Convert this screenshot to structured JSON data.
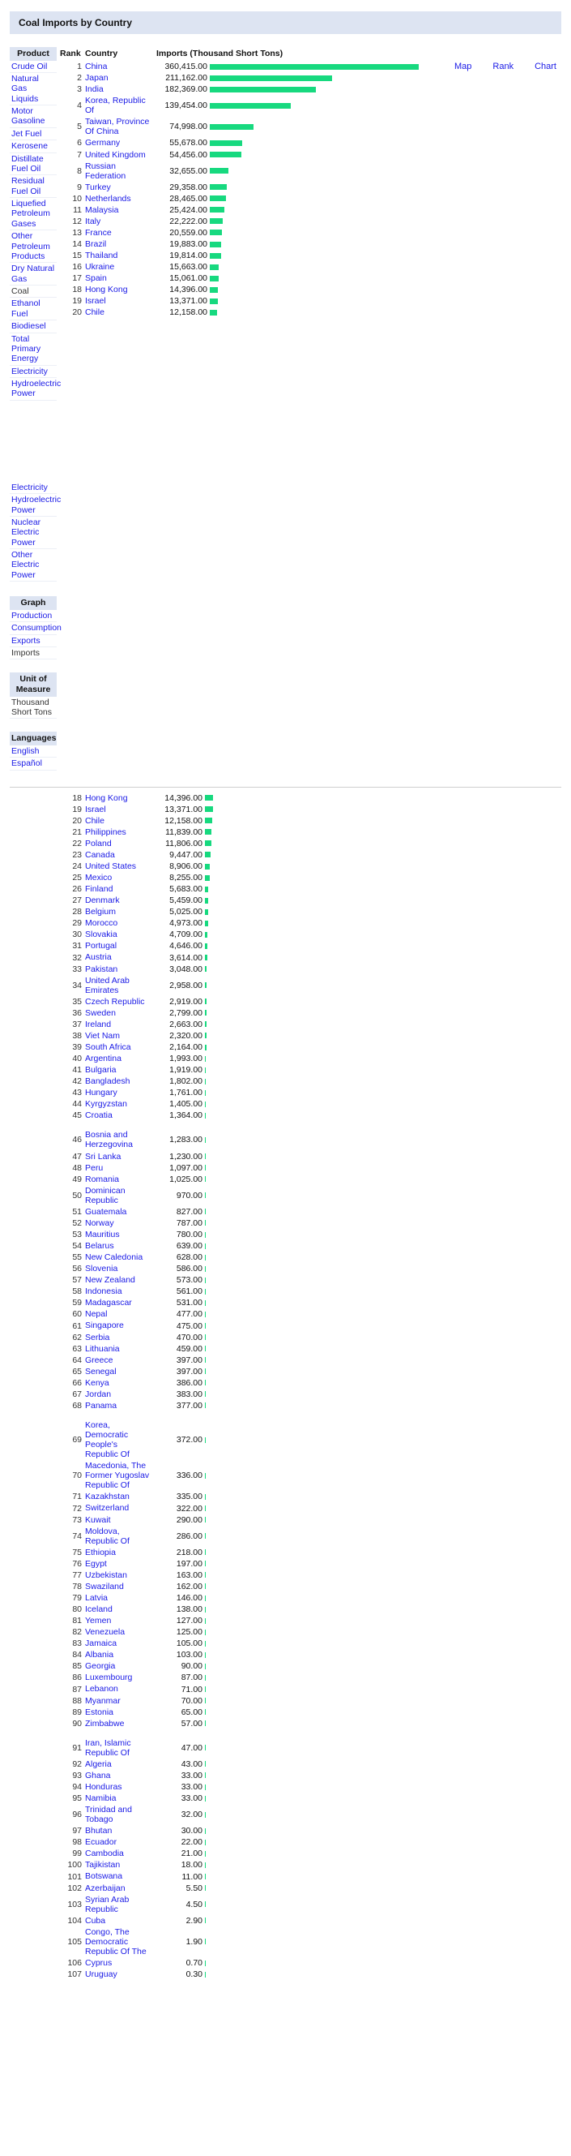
{
  "page": {
    "title": "Coal Imports by Country"
  },
  "view_links": [
    {
      "label": "Map",
      "name": "map-view-link"
    },
    {
      "label": "Rank",
      "name": "rank-view-link"
    },
    {
      "label": "Chart",
      "name": "chart-view-link"
    }
  ],
  "sidebar": {
    "product": {
      "header": "Product",
      "items": [
        {
          "label": "Crude Oil",
          "current": false
        },
        {
          "label": "Natural Gas Liquids",
          "current": false
        },
        {
          "label": "Motor Gasoline",
          "current": false
        },
        {
          "label": "Jet Fuel",
          "current": false
        },
        {
          "label": "Kerosene",
          "current": false
        },
        {
          "label": "Distillate Fuel Oil",
          "current": false
        },
        {
          "label": "Residual Fuel Oil",
          "current": false
        },
        {
          "label": "Liquefied Petroleum Gases",
          "current": false
        },
        {
          "label": "Other Petroleum Products",
          "current": false
        },
        {
          "label": "Dry Natural Gas",
          "current": false
        },
        {
          "label": "Coal",
          "current": true
        },
        {
          "label": "Ethanol Fuel",
          "current": false
        },
        {
          "label": "Biodiesel",
          "current": false
        },
        {
          "label": "Total Primary Energy",
          "current": false
        },
        {
          "label": "Electricity",
          "current": false
        },
        {
          "label": "Hydroelectric Power",
          "current": false
        }
      ]
    },
    "product_continued": {
      "items": [
        {
          "label": "Electricity",
          "current": false
        },
        {
          "label": "Hydroelectric Power",
          "current": false
        },
        {
          "label": "Nuclear Electric Power",
          "current": false
        },
        {
          "label": "Other Electric Power",
          "current": false
        }
      ]
    },
    "graph": {
      "header": "Graph",
      "items": [
        {
          "label": "Production",
          "current": false
        },
        {
          "label": "Consumption",
          "current": false
        },
        {
          "label": "Exports",
          "current": false
        },
        {
          "label": "Imports",
          "current": true
        }
      ]
    },
    "unit": {
      "header": "Unit of Measure",
      "items": [
        {
          "label": "Thousand Short Tons",
          "current": true
        }
      ]
    },
    "languages": {
      "header": "Languages",
      "items": [
        {
          "label": "English",
          "current": false
        },
        {
          "label": "Español",
          "current": false
        }
      ]
    }
  },
  "table": {
    "headers": {
      "rank": "Rank",
      "country": "Country",
      "value": "Imports (Thousand Short Tons)"
    }
  },
  "chart_data": {
    "type": "bar",
    "title": "Coal Imports by Country",
    "xlabel": "Imports (Thousand Short Tons)",
    "ylabel": "Country",
    "unit": "Thousand Short Tons",
    "max_value": 360415,
    "bar_color": "#17d97f",
    "section1": [
      {
        "rank": "1",
        "country": "China",
        "value": "360,415.00",
        "n": 360415
      },
      {
        "rank": "2",
        "country": "Japan",
        "value": "211,162.00",
        "n": 211162
      },
      {
        "rank": "3",
        "country": "India",
        "value": "182,369.00",
        "n": 182369
      },
      {
        "rank": "4",
        "country": "Korea, Republic Of",
        "value": "139,454.00",
        "n": 139454
      },
      {
        "rank": "5",
        "country": "Taiwan, Province Of China",
        "value": "74,998.00",
        "n": 74998
      },
      {
        "rank": "6",
        "country": "Germany",
        "value": "55,678.00",
        "n": 55678
      },
      {
        "rank": "7",
        "country": "United Kingdom",
        "value": "54,456.00",
        "n": 54456
      },
      {
        "rank": "8",
        "country": "Russian Federation",
        "value": "32,655.00",
        "n": 32655
      },
      {
        "rank": "9",
        "country": "Turkey",
        "value": "29,358.00",
        "n": 29358
      },
      {
        "rank": "10",
        "country": "Netherlands",
        "value": "28,465.00",
        "n": 28465
      },
      {
        "rank": "11",
        "country": "Malaysia",
        "value": "25,424.00",
        "n": 25424
      },
      {
        "rank": "12",
        "country": "Italy",
        "value": "22,222.00",
        "n": 22222
      },
      {
        "rank": "13",
        "country": "France",
        "value": "20,559.00",
        "n": 20559
      },
      {
        "rank": "14",
        "country": "Brazil",
        "value": "19,883.00",
        "n": 19883
      },
      {
        "rank": "15",
        "country": "Thailand",
        "value": "19,814.00",
        "n": 19814
      },
      {
        "rank": "16",
        "country": "Ukraine",
        "value": "15,663.00",
        "n": 15663
      },
      {
        "rank": "17",
        "country": "Spain",
        "value": "15,061.00",
        "n": 15061
      },
      {
        "rank": "18",
        "country": "Hong Kong",
        "value": "14,396.00",
        "n": 14396
      },
      {
        "rank": "19",
        "country": "Israel",
        "value": "13,371.00",
        "n": 13371
      },
      {
        "rank": "20",
        "country": "Chile",
        "value": "12,158.00",
        "n": 12158
      }
    ],
    "section2": [
      {
        "rank": "18",
        "country": "Hong Kong",
        "value": "14,396.00",
        "n": 14396
      },
      {
        "rank": "19",
        "country": "Israel",
        "value": "13,371.00",
        "n": 13371
      },
      {
        "rank": "20",
        "country": "Chile",
        "value": "12,158.00",
        "n": 12158
      },
      {
        "rank": "21",
        "country": "Philippines",
        "value": "11,839.00",
        "n": 11839
      },
      {
        "rank": "22",
        "country": "Poland",
        "value": "11,806.00",
        "n": 11806
      },
      {
        "rank": "23",
        "country": "Canada",
        "value": "9,447.00",
        "n": 9447
      },
      {
        "rank": "24",
        "country": "United States",
        "value": "8,906.00",
        "n": 8906
      },
      {
        "rank": "25",
        "country": "Mexico",
        "value": "8,255.00",
        "n": 8255
      },
      {
        "rank": "26",
        "country": "Finland",
        "value": "5,683.00",
        "n": 5683
      },
      {
        "rank": "27",
        "country": "Denmark",
        "value": "5,459.00",
        "n": 5459
      },
      {
        "rank": "28",
        "country": "Belgium",
        "value": "5,025.00",
        "n": 5025
      },
      {
        "rank": "29",
        "country": "Morocco",
        "value": "4,973.00",
        "n": 4973
      },
      {
        "rank": "30",
        "country": "Slovakia",
        "value": "4,709.00",
        "n": 4709
      },
      {
        "rank": "31",
        "country": "Portugal",
        "value": "4,646.00",
        "n": 4646
      },
      {
        "rank": "32",
        "country": "Austria",
        "value": "3,614.00",
        "n": 3614
      },
      {
        "rank": "33",
        "country": "Pakistan",
        "value": "3,048.00",
        "n": 3048
      },
      {
        "rank": "34",
        "country": "United Arab Emirates",
        "value": "2,958.00",
        "n": 2958
      },
      {
        "rank": "35",
        "country": "Czech Republic",
        "value": "2,919.00",
        "n": 2919
      },
      {
        "rank": "36",
        "country": "Sweden",
        "value": "2,799.00",
        "n": 2799
      },
      {
        "rank": "37",
        "country": "Ireland",
        "value": "2,663.00",
        "n": 2663
      },
      {
        "rank": "38",
        "country": "Viet Nam",
        "value": "2,320.00",
        "n": 2320
      },
      {
        "rank": "39",
        "country": "South Africa",
        "value": "2,164.00",
        "n": 2164
      },
      {
        "rank": "40",
        "country": "Argentina",
        "value": "1,993.00",
        "n": 1993
      },
      {
        "rank": "41",
        "country": "Bulgaria",
        "value": "1,919.00",
        "n": 1919
      },
      {
        "rank": "42",
        "country": "Bangladesh",
        "value": "1,802.00",
        "n": 1802
      },
      {
        "rank": "43",
        "country": "Hungary",
        "value": "1,761.00",
        "n": 1761
      },
      {
        "rank": "44",
        "country": "Kyrgyzstan",
        "value": "1,405.00",
        "n": 1405
      },
      {
        "rank": "45",
        "country": "Croatia",
        "value": "1,364.00",
        "n": 1364
      }
    ],
    "section3": [
      {
        "rank": "46",
        "country": "Bosnia and Herzegovina",
        "value": "1,283.00",
        "n": 1283
      },
      {
        "rank": "47",
        "country": "Sri Lanka",
        "value": "1,230.00",
        "n": 1230
      },
      {
        "rank": "48",
        "country": "Peru",
        "value": "1,097.00",
        "n": 1097
      },
      {
        "rank": "49",
        "country": "Romania",
        "value": "1,025.00",
        "n": 1025
      },
      {
        "rank": "50",
        "country": "Dominican Republic",
        "value": "970.00",
        "n": 970
      },
      {
        "rank": "51",
        "country": "Guatemala",
        "value": "827.00",
        "n": 827
      },
      {
        "rank": "52",
        "country": "Norway",
        "value": "787.00",
        "n": 787
      },
      {
        "rank": "53",
        "country": "Mauritius",
        "value": "780.00",
        "n": 780
      },
      {
        "rank": "54",
        "country": "Belarus",
        "value": "639.00",
        "n": 639
      },
      {
        "rank": "55",
        "country": "New Caledonia",
        "value": "628.00",
        "n": 628
      },
      {
        "rank": "56",
        "country": "Slovenia",
        "value": "586.00",
        "n": 586
      },
      {
        "rank": "57",
        "country": "New Zealand",
        "value": "573.00",
        "n": 573
      },
      {
        "rank": "58",
        "country": "Indonesia",
        "value": "561.00",
        "n": 561
      },
      {
        "rank": "59",
        "country": "Madagascar",
        "value": "531.00",
        "n": 531
      },
      {
        "rank": "60",
        "country": "Nepal",
        "value": "477.00",
        "n": 477
      },
      {
        "rank": "61",
        "country": "Singapore",
        "value": "475.00",
        "n": 475
      },
      {
        "rank": "62",
        "country": "Serbia",
        "value": "470.00",
        "n": 470
      },
      {
        "rank": "63",
        "country": "Lithuania",
        "value": "459.00",
        "n": 459
      },
      {
        "rank": "64",
        "country": "Greece",
        "value": "397.00",
        "n": 397
      },
      {
        "rank": "65",
        "country": "Senegal",
        "value": "397.00",
        "n": 397
      },
      {
        "rank": "66",
        "country": "Kenya",
        "value": "386.00",
        "n": 386
      },
      {
        "rank": "67",
        "country": "Jordan",
        "value": "383.00",
        "n": 383
      },
      {
        "rank": "68",
        "country": "Panama",
        "value": "377.00",
        "n": 377
      }
    ],
    "section4": [
      {
        "rank": "69",
        "country": "Korea, Democratic People's Republic Of",
        "value": "372.00",
        "n": 372
      },
      {
        "rank": "70",
        "country": "Macedonia, The Former Yugoslav Republic Of",
        "value": "336.00",
        "n": 336
      },
      {
        "rank": "71",
        "country": "Kazakhstan",
        "value": "335.00",
        "n": 335
      },
      {
        "rank": "72",
        "country": "Switzerland",
        "value": "322.00",
        "n": 322
      },
      {
        "rank": "73",
        "country": "Kuwait",
        "value": "290.00",
        "n": 290
      },
      {
        "rank": "74",
        "country": "Moldova, Republic Of",
        "value": "286.00",
        "n": 286
      },
      {
        "rank": "75",
        "country": "Ethiopia",
        "value": "218.00",
        "n": 218
      },
      {
        "rank": "76",
        "country": "Egypt",
        "value": "197.00",
        "n": 197
      },
      {
        "rank": "77",
        "country": "Uzbekistan",
        "value": "163.00",
        "n": 163
      },
      {
        "rank": "78",
        "country": "Swaziland",
        "value": "162.00",
        "n": 162
      },
      {
        "rank": "79",
        "country": "Latvia",
        "value": "146.00",
        "n": 146
      },
      {
        "rank": "80",
        "country": "Iceland",
        "value": "138.00",
        "n": 138
      },
      {
        "rank": "81",
        "country": "Yemen",
        "value": "127.00",
        "n": 127
      },
      {
        "rank": "82",
        "country": "Venezuela",
        "value": "125.00",
        "n": 125
      },
      {
        "rank": "83",
        "country": "Jamaica",
        "value": "105.00",
        "n": 105
      },
      {
        "rank": "84",
        "country": "Albania",
        "value": "103.00",
        "n": 103
      },
      {
        "rank": "85",
        "country": "Georgia",
        "value": "90.00",
        "n": 90
      },
      {
        "rank": "86",
        "country": "Luxembourg",
        "value": "87.00",
        "n": 87
      },
      {
        "rank": "87",
        "country": "Lebanon",
        "value": "71.00",
        "n": 71
      },
      {
        "rank": "88",
        "country": "Myanmar",
        "value": "70.00",
        "n": 70
      },
      {
        "rank": "89",
        "country": "Estonia",
        "value": "65.00",
        "n": 65
      },
      {
        "rank": "90",
        "country": "Zimbabwe",
        "value": "57.00",
        "n": 57
      }
    ],
    "section5": [
      {
        "rank": "91",
        "country": "Iran, Islamic Republic Of",
        "value": "47.00",
        "n": 47
      },
      {
        "rank": "92",
        "country": "Algeria",
        "value": "43.00",
        "n": 43
      },
      {
        "rank": "93",
        "country": "Ghana",
        "value": "33.00",
        "n": 33
      },
      {
        "rank": "94",
        "country": "Honduras",
        "value": "33.00",
        "n": 33
      },
      {
        "rank": "95",
        "country": "Namibia",
        "value": "33.00",
        "n": 33
      },
      {
        "rank": "96",
        "country": "Trinidad and Tobago",
        "value": "32.00",
        "n": 32
      },
      {
        "rank": "97",
        "country": "Bhutan",
        "value": "30.00",
        "n": 30
      },
      {
        "rank": "98",
        "country": "Ecuador",
        "value": "22.00",
        "n": 22
      },
      {
        "rank": "99",
        "country": "Cambodia",
        "value": "21.00",
        "n": 21
      },
      {
        "rank": "100",
        "country": "Tajikistan",
        "value": "18.00",
        "n": 18
      },
      {
        "rank": "101",
        "country": "Botswana",
        "value": "11.00",
        "n": 11
      },
      {
        "rank": "102",
        "country": "Azerbaijan",
        "value": "5.50",
        "n": 5.5
      },
      {
        "rank": "103",
        "country": "Syrian Arab Republic",
        "value": "4.50",
        "n": 4.5
      },
      {
        "rank": "104",
        "country": "Cuba",
        "value": "2.90",
        "n": 2.9
      },
      {
        "rank": "105",
        "country": "Congo, The Democratic Republic Of The",
        "value": "1.90",
        "n": 1.9
      },
      {
        "rank": "106",
        "country": "Cyprus",
        "value": "0.70",
        "n": 0.7
      },
      {
        "rank": "107",
        "country": "Uruguay",
        "value": "0.30",
        "n": 0.3
      }
    ]
  }
}
